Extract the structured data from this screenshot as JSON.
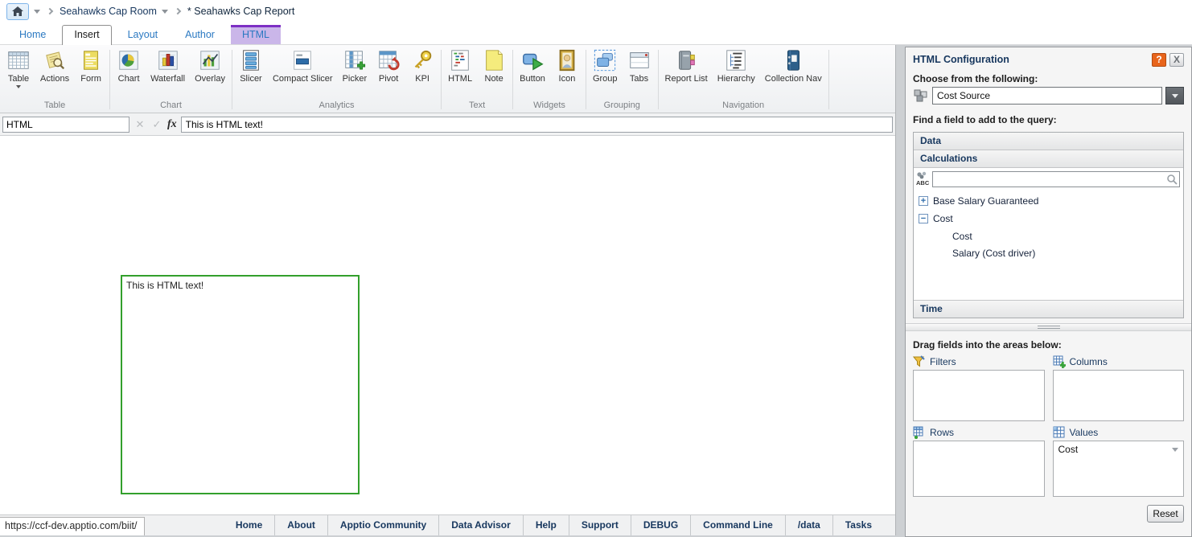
{
  "breadcrumb": {
    "collection": "Seahawks Cap Room",
    "report": "* Seahawks Cap Report"
  },
  "tabs": [
    {
      "label": "Home"
    },
    {
      "label": "Insert"
    },
    {
      "label": "Layout"
    },
    {
      "label": "Author"
    },
    {
      "label": "HTML"
    }
  ],
  "ribbon": {
    "groups": [
      {
        "label": "Table",
        "items": [
          {
            "label": "Table"
          },
          {
            "label": "Actions"
          },
          {
            "label": "Form"
          }
        ]
      },
      {
        "label": "Chart",
        "items": [
          {
            "label": "Chart"
          },
          {
            "label": "Waterfall"
          },
          {
            "label": "Overlay"
          }
        ]
      },
      {
        "label": "Analytics",
        "items": [
          {
            "label": "Slicer"
          },
          {
            "label": "Compact Slicer"
          },
          {
            "label": "Picker"
          },
          {
            "label": "Pivot"
          },
          {
            "label": "KPI"
          }
        ]
      },
      {
        "label": "Text",
        "items": [
          {
            "label": "HTML"
          },
          {
            "label": "Note"
          }
        ]
      },
      {
        "label": "Widgets",
        "items": [
          {
            "label": "Button"
          },
          {
            "label": "Icon"
          }
        ]
      },
      {
        "label": "Grouping",
        "items": [
          {
            "label": "Group"
          },
          {
            "label": "Tabs"
          }
        ]
      },
      {
        "label": "Navigation",
        "items": [
          {
            "label": "Report List"
          },
          {
            "label": "Hierarchy"
          },
          {
            "label": "Collection Nav"
          }
        ]
      }
    ]
  },
  "formula_bar": {
    "name_box": "HTML",
    "cancel_glyph": "✕",
    "accept_glyph": "✓",
    "fx_label": "fx",
    "formula": "This is HTML text!"
  },
  "canvas": {
    "html_widget_text": "This is HTML text!"
  },
  "panel": {
    "title": "HTML Configuration",
    "help_label": "?",
    "close_label": "X",
    "choose_label": "Choose from the following:",
    "source_value": "Cost Source",
    "find_label": "Find a field to add to the query:",
    "section_data": "Data",
    "section_calculations": "Calculations",
    "section_time": "Time",
    "search_value": "",
    "tree": [
      {
        "expander": "+",
        "label": "Base Salary Guaranteed",
        "children": []
      },
      {
        "expander": "−",
        "label": "Cost",
        "children": [
          "Cost",
          "Salary (Cost driver)"
        ]
      }
    ],
    "drag_label": "Drag fields into the areas below:",
    "areas": [
      {
        "label": "Filters",
        "items": []
      },
      {
        "label": "Columns",
        "items": []
      },
      {
        "label": "Rows",
        "items": []
      },
      {
        "label": "Values",
        "items": [
          "Cost"
        ]
      }
    ],
    "reset_label": "Reset"
  },
  "status_bar": {
    "url": "https://ccf-dev.apptio.com/biit/",
    "links": [
      "Home",
      "About",
      "Apptio Community",
      "Data Advisor",
      "Help",
      "Support",
      "DEBUG",
      "Command Line",
      "/data",
      "Tasks"
    ]
  },
  "colors": {
    "accent_purple": "#7d2fc4",
    "tab_blue": "#2b79c2",
    "widget_green": "#33a02c",
    "help_orange": "#e8641b",
    "navy": "#17375e"
  }
}
